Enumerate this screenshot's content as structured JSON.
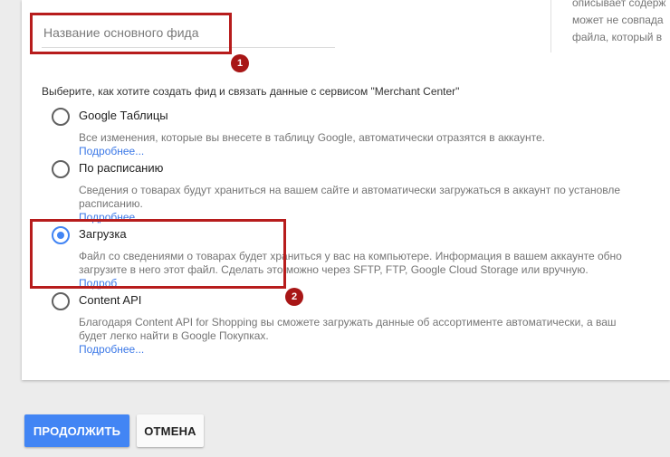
{
  "feed_name": {
    "placeholder": "Название основного фида",
    "value": ""
  },
  "side_help": [
    "описывает содерж",
    "может не совпада",
    "файла, который в"
  ],
  "method_prompt": "Выберите, как хотите создать фид и связать данные с сервисом \"Merchant Center\"",
  "options": [
    {
      "label": "Google Таблицы",
      "desc_lines": [
        "Все изменения, которые вы внесете в таблицу Google, автоматически отразятся в аккаунте."
      ],
      "more": "Подробнее...",
      "selected": false
    },
    {
      "label": "По расписанию",
      "desc_lines": [
        "Сведения о товарах будут храниться на вашем сайте и автоматически загружаться в аккаунт по установле",
        "расписанию."
      ],
      "more": "Подробнее...",
      "selected": false
    },
    {
      "label": "Загрузка",
      "desc_lines": [
        "Файл со сведениями о товарах будет храниться у вас на компьютере. Информация в вашем аккаунте обно",
        "загрузите в него этот файл. Сделать это можно через SFTP, FTP, Google Cloud Storage или вручную."
      ],
      "more": "Подроб",
      "selected": true
    },
    {
      "label": "Content API",
      "desc_lines": [
        "Благодаря Content API for Shopping вы сможете загружать данные об ассортименте автоматически, а ваш",
        "будет легко найти в Google Покупках."
      ],
      "more": "Подробнее...",
      "selected": false
    }
  ],
  "annotations": [
    "1",
    "2"
  ],
  "buttons": {
    "continue": "ПРОДОЛЖИТЬ",
    "cancel": "ОТМЕНА"
  },
  "colors": {
    "accent": "#4285f4",
    "annotation": "#b71c1c",
    "link": "#3b78e7"
  }
}
